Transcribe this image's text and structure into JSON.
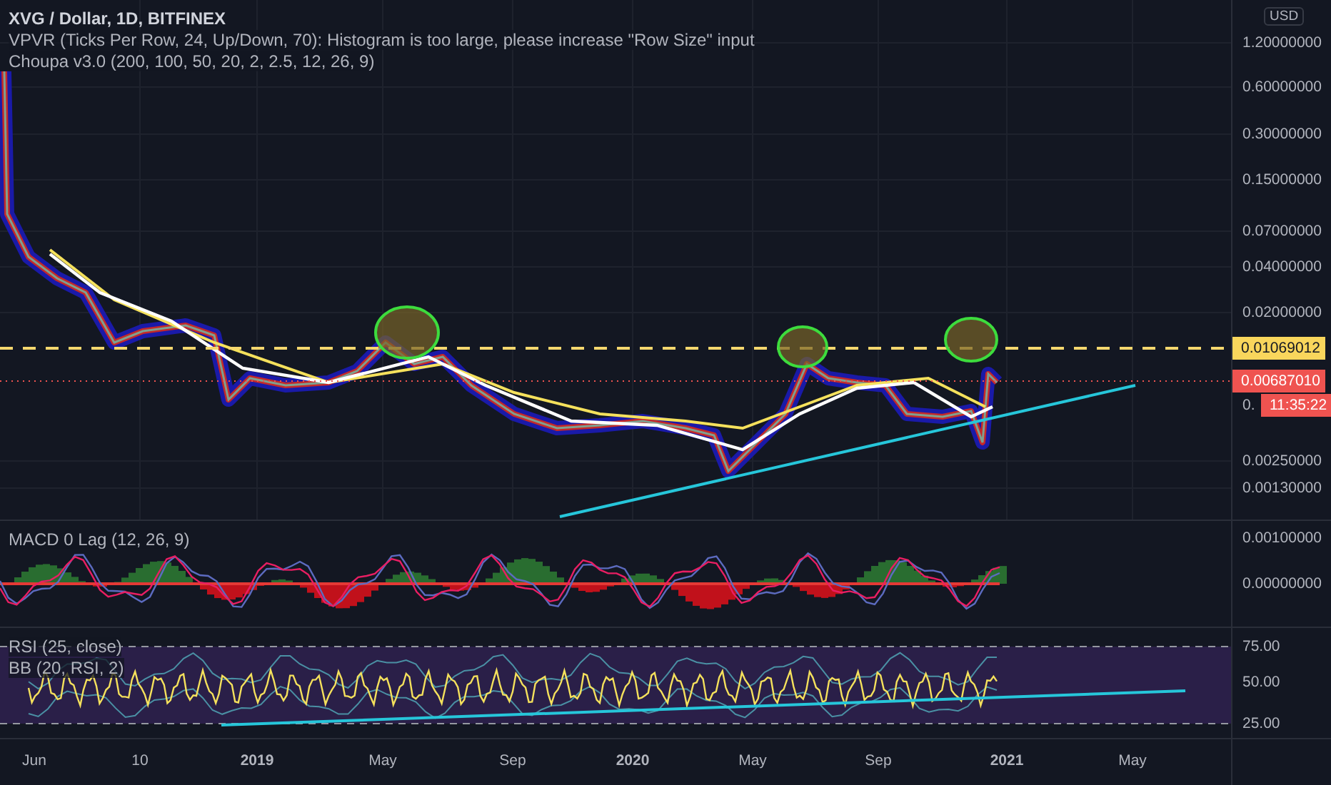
{
  "legend": {
    "title": "XVG / Dollar, 1D, BITFINEX",
    "indicators": [
      "VPVR (Ticks Per Row, 24, Up/Down, 70): Histogram is too large, please increase \"Row Size\" input",
      "Choupa v3.0 (200, 100, 50, 20, 2, 2.5, 12, 26, 9)"
    ]
  },
  "price_axis": {
    "currency": "USD",
    "ticks": [
      "1.20000000",
      "0.60000000",
      "0.30000000",
      "0.15000000",
      "0.07000000",
      "0.04000000",
      "0.02000000",
      "0.00250000",
      "0.00130000"
    ],
    "level_label": "0.01069012",
    "last_price": "0.00687010",
    "partial_tick": "0.",
    "countdown": "11:35:22"
  },
  "macd": {
    "title": "MACD 0 Lag (12, 26, 9)",
    "ticks": [
      "0.00100000",
      "0.00000000"
    ]
  },
  "rsi": {
    "titles": [
      "RSI (25, close)",
      "BB (20, RSI, 2)"
    ],
    "ticks": [
      "75.00",
      "50.00",
      "25.00"
    ]
  },
  "time_axis": {
    "labels": [
      {
        "text": "Jun",
        "bold": false
      },
      {
        "text": "10",
        "bold": false
      },
      {
        "text": "2019",
        "bold": true
      },
      {
        "text": "May",
        "bold": false
      },
      {
        "text": "Sep",
        "bold": false
      },
      {
        "text": "2020",
        "bold": true
      },
      {
        "text": "May",
        "bold": false
      },
      {
        "text": "Sep",
        "bold": false
      },
      {
        "text": "2021",
        "bold": true
      },
      {
        "text": "May",
        "bold": false
      }
    ]
  }
}
